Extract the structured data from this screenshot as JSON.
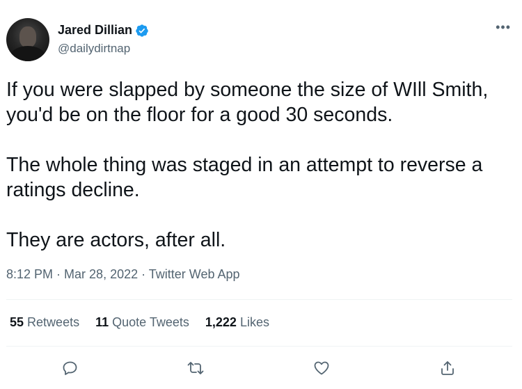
{
  "author": {
    "display_name": "Jared Dillian",
    "handle": "@dailydirtnap",
    "verified": true
  },
  "tweet": {
    "paragraphs": [
      "If you were slapped by someone the size of WIll Smith, you'd be on the floor for a good 30 seconds.",
      "The whole thing was staged in an attempt to reverse a ratings decline.",
      "They are actors, after all."
    ],
    "time": "8:12 PM",
    "date": "Mar 28, 2022",
    "source": "Twitter Web App",
    "separator": " · "
  },
  "stats": {
    "retweets_count": "55",
    "retweets_label": "Retweets",
    "quotes_count": "11",
    "quotes_label": "Quote Tweets",
    "likes_count": "1,222",
    "likes_label": "Likes"
  },
  "icons": {
    "more": "more-icon",
    "reply": "reply-icon",
    "retweet": "retweet-icon",
    "like": "heart-icon",
    "share": "share-icon",
    "verified": "verified-badge-icon"
  },
  "colors": {
    "verified": "#1d9bf0",
    "secondary_text": "#536471",
    "primary_text": "#0f1419"
  }
}
